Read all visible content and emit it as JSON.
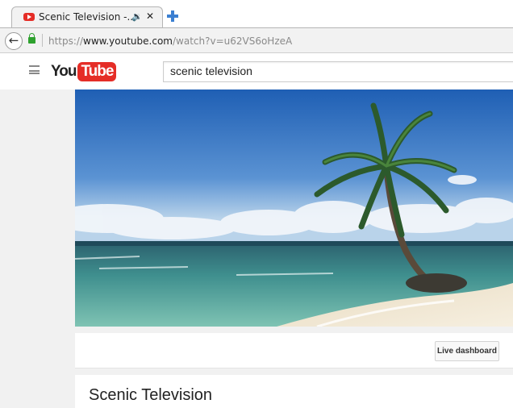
{
  "browser": {
    "tab": {
      "title": "Scenic Television -...",
      "audio_icon": "speaker-icon",
      "close_icon": "close-icon"
    },
    "new_tab_icon": "plus-icon",
    "address_bar": {
      "scheme": "https://",
      "host": "www.youtube.com",
      "path": "/watch?v=u62VS6oHzeA"
    },
    "back_icon": "back-arrow-icon",
    "lock_icon": "lock-icon"
  },
  "youtube": {
    "menu_icon": "hamburger-icon",
    "logo": {
      "you": "You",
      "tube": "Tube"
    },
    "search": {
      "value": "scenic television"
    },
    "live_dashboard_label": "Live dashboard",
    "video_title": "Scenic Television"
  },
  "colors": {
    "brand_red": "#e52d27",
    "lock_green": "#2ea12e",
    "new_tab_blue": "#3b7fd1"
  }
}
